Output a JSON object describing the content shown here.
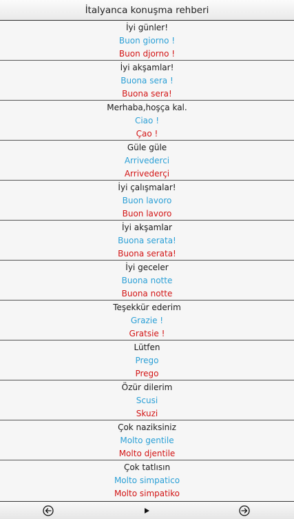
{
  "header": {
    "title": "İtalyanca konuşma rehberi"
  },
  "phrases": [
    {
      "turkish": "İyi günler!",
      "italian": "Buon giorno !",
      "pronunciation": "Buon djorno !"
    },
    {
      "turkish": "İyi akşamlar!",
      "italian": "Buona sera !",
      "pronunciation": "Buona sera!"
    },
    {
      "turkish": "Merhaba,hoşça kal.",
      "italian": "Ciao !",
      "pronunciation": "Çao !"
    },
    {
      "turkish": "Güle güle",
      "italian": "Arrivederci",
      "pronunciation": "Arrivederçi"
    },
    {
      "turkish": "İyi çalışmalar!",
      "italian": "Buon lavoro",
      "pronunciation": "Buon lavoro"
    },
    {
      "turkish": "İyi akşamlar",
      "italian": "Buona serata!",
      "pronunciation": "Buona serata!"
    },
    {
      "turkish": "İyi geceler",
      "italian": "Buona notte",
      "pronunciation": "Buona notte"
    },
    {
      "turkish": "Teşekkür ederim",
      "italian": "Grazie !",
      "pronunciation": "Gratsie !"
    },
    {
      "turkish": "Lütfen",
      "italian": "Prego",
      "pronunciation": "Prego"
    },
    {
      "turkish": "Özür dilerim",
      "italian": "Scusi",
      "pronunciation": "Skuzi"
    },
    {
      "turkish": "Çok naziksiniz",
      "italian": "Molto gentile",
      "pronunciation": "Molto djentile"
    },
    {
      "turkish": "Çok tatlısın",
      "italian": "Molto simpatico",
      "pronunciation": "Molto simpatiko"
    }
  ],
  "toolbar": {
    "prev_icon": "circle-arrow-left-icon",
    "play_icon": "play-icon",
    "next_icon": "circle-arrow-right-icon"
  },
  "colors": {
    "turkish_text": "#1a1a1a",
    "italian_text": "#2a9fd6",
    "pronunciation_text": "#d21414"
  }
}
